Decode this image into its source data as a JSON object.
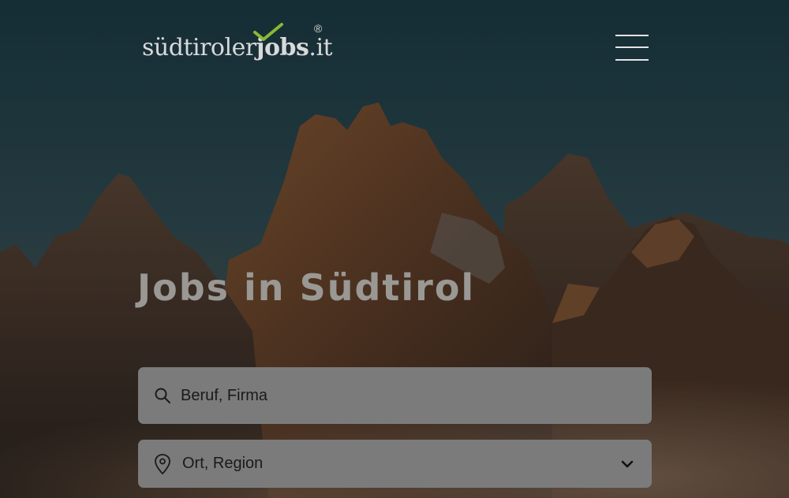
{
  "header": {
    "logo": {
      "text_light": "südtiroler",
      "text_bold": "jobs",
      "text_suffix": ".it",
      "registered_mark": "®"
    },
    "menu_icon": "hamburger-menu-icon"
  },
  "hero": {
    "title": "Jobs in Südtirol"
  },
  "search": {
    "icon": "search-icon",
    "placeholder": "Beruf, Firma",
    "value": ""
  },
  "location": {
    "icon": "map-pin-icon",
    "selected": "Ort, Region",
    "dropdown_icon": "chevron-down-icon"
  },
  "colors": {
    "checkmark": "#8ab833",
    "field_background": "#7b7b7b",
    "headline": "#9a9894"
  }
}
